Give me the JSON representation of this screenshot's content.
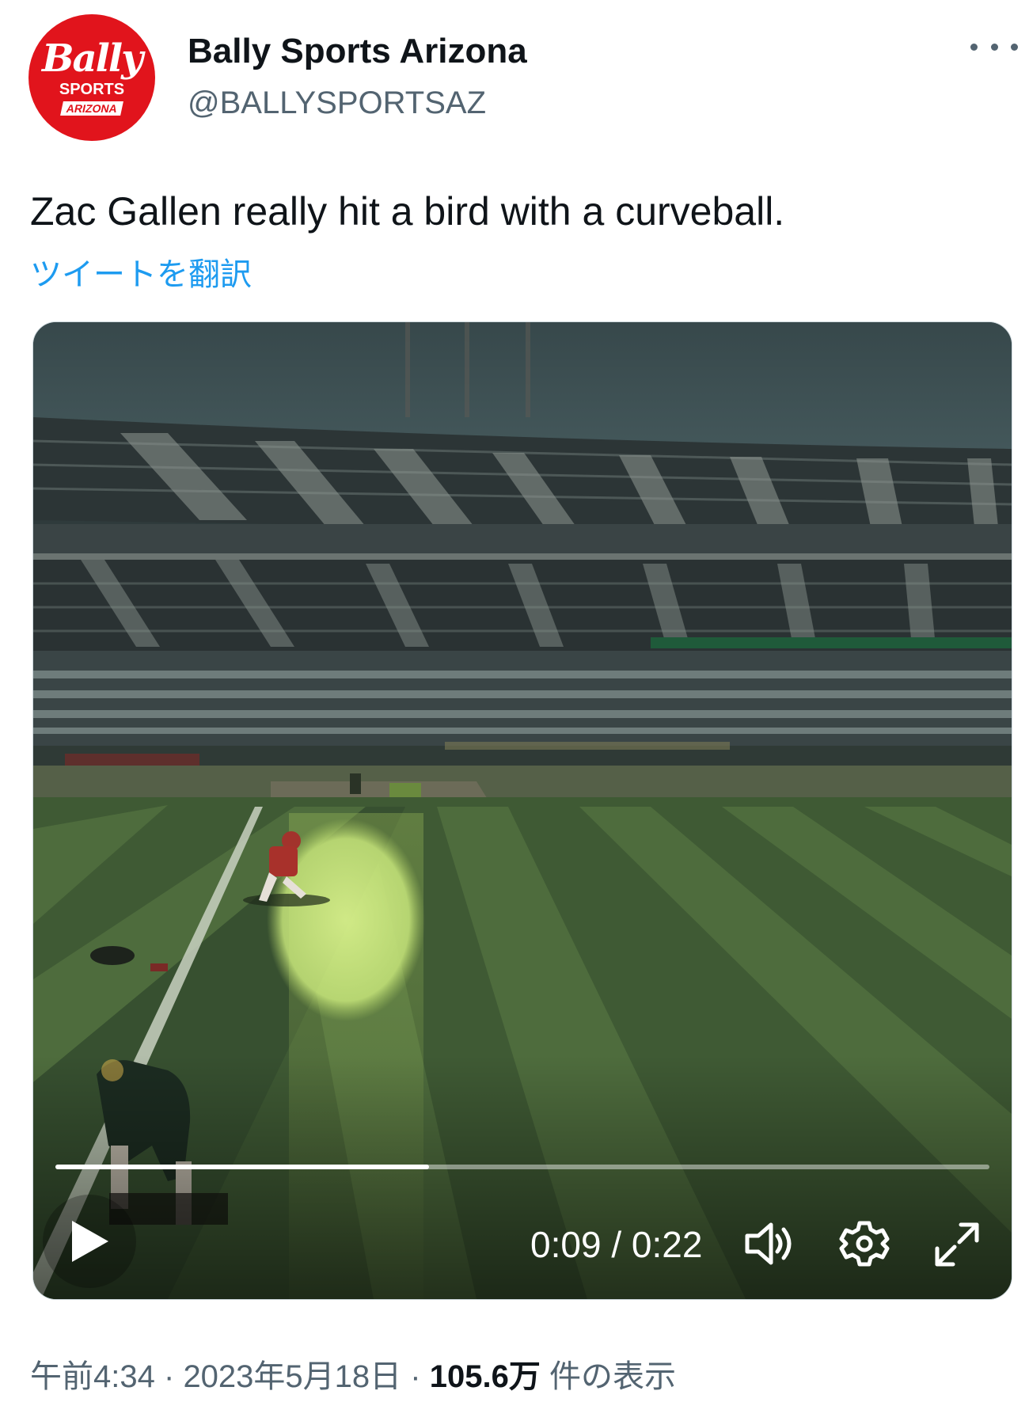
{
  "account": {
    "display_name": "Bally Sports Arizona",
    "handle": "@BALLYSPORTSAZ",
    "avatar_brand": "Bally",
    "avatar_line1": "SPORTS",
    "avatar_line2": "ARIZONA"
  },
  "tweet": {
    "text": "Zac Gallen really hit a bird with a curveball.",
    "translate_link": "ツイートを翻訳"
  },
  "video": {
    "current_time": "0:09",
    "separator": "/",
    "duration": "0:22",
    "progress": 0.4
  },
  "meta": {
    "time": "午前4:34",
    "date": "2023年5月18日",
    "dot": "·",
    "views": "105.6万",
    "views_label": "件の表示"
  },
  "colors": {
    "brand_red": "#e1141c",
    "link_blue": "#1d9bf0",
    "muted": "#536471"
  },
  "icons": [
    "more-icon",
    "play-icon",
    "volume-icon",
    "settings-icon",
    "fullscreen-icon"
  ]
}
